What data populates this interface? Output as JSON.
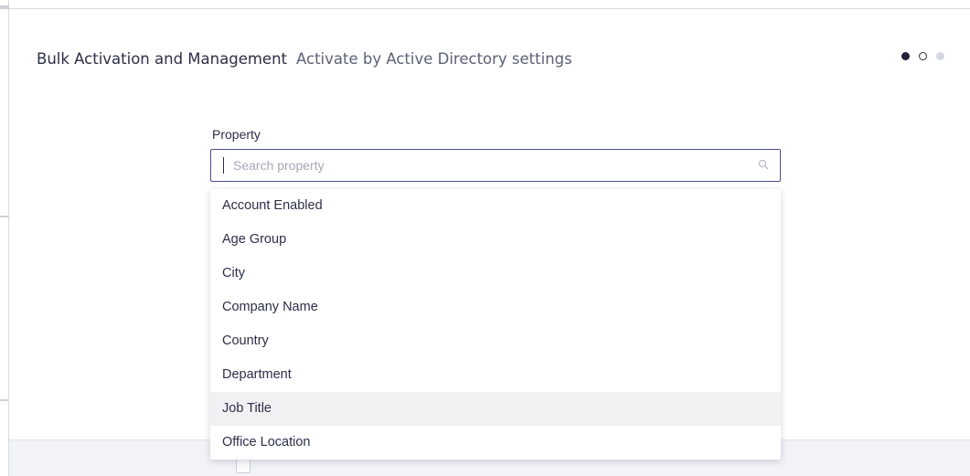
{
  "header": {
    "title": "Bulk Activation and Management",
    "subtitle": "Activate by Active Directory settings"
  },
  "stepper": {
    "total_steps": 3,
    "current_step": 1
  },
  "property_field": {
    "label": "Property",
    "placeholder": "Search property",
    "value": "",
    "icon": "search-icon"
  },
  "dropdown": {
    "options": [
      "Account Enabled",
      "Age Group",
      "City",
      "Company Name",
      "Country",
      "Department",
      "Job Title",
      "Office Location"
    ],
    "hovered_option": "Job Title"
  },
  "colors": {
    "accent": "#4b4f8e",
    "text_primary": "#2b2f47",
    "text_secondary": "#5b6178",
    "hover_background": "#f1f1f4",
    "footer_background": "#f2f3f6"
  }
}
